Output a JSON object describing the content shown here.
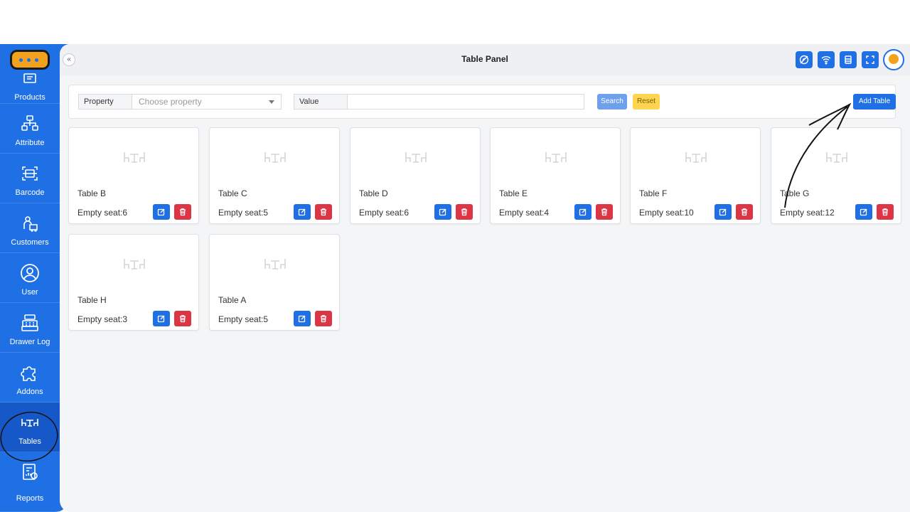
{
  "app": {
    "title": "Table Panel",
    "accent": "#1f6fe5",
    "danger": "#dc3545",
    "warning": "#ffd54f"
  },
  "sidebar": {
    "items": [
      {
        "label": "Products",
        "icon": "products-icon"
      },
      {
        "label": "Attribute",
        "icon": "attribute-icon"
      },
      {
        "label": "Barcode",
        "icon": "barcode-icon"
      },
      {
        "label": "Customers",
        "icon": "customers-icon"
      },
      {
        "label": "User",
        "icon": "user-icon"
      },
      {
        "label": "Drawer Log",
        "icon": "cash-register-icon"
      },
      {
        "label": "Addons",
        "icon": "puzzle-icon"
      },
      {
        "label": "Tables",
        "icon": "table-icon",
        "active": true
      },
      {
        "label": "Reports",
        "icon": "reports-icon"
      }
    ]
  },
  "filter": {
    "property_label": "Property",
    "property_placeholder": "Choose property",
    "value_label": "Value",
    "value_placeholder": "",
    "search_label": "Search",
    "reset_label": "Reset",
    "add_label": "Add Table"
  },
  "tables": [
    {
      "name": "Table B",
      "seats": "Empty seat:6"
    },
    {
      "name": "Table C",
      "seats": "Empty seat:5"
    },
    {
      "name": "Table D",
      "seats": "Empty seat:6"
    },
    {
      "name": "Table E",
      "seats": "Empty seat:4"
    },
    {
      "name": "Table F",
      "seats": "Empty seat:10"
    },
    {
      "name": "Table G",
      "seats": "Empty seat:12"
    },
    {
      "name": "Table H",
      "seats": "Empty seat:3"
    },
    {
      "name": "Table A",
      "seats": "Empty seat:5"
    }
  ]
}
